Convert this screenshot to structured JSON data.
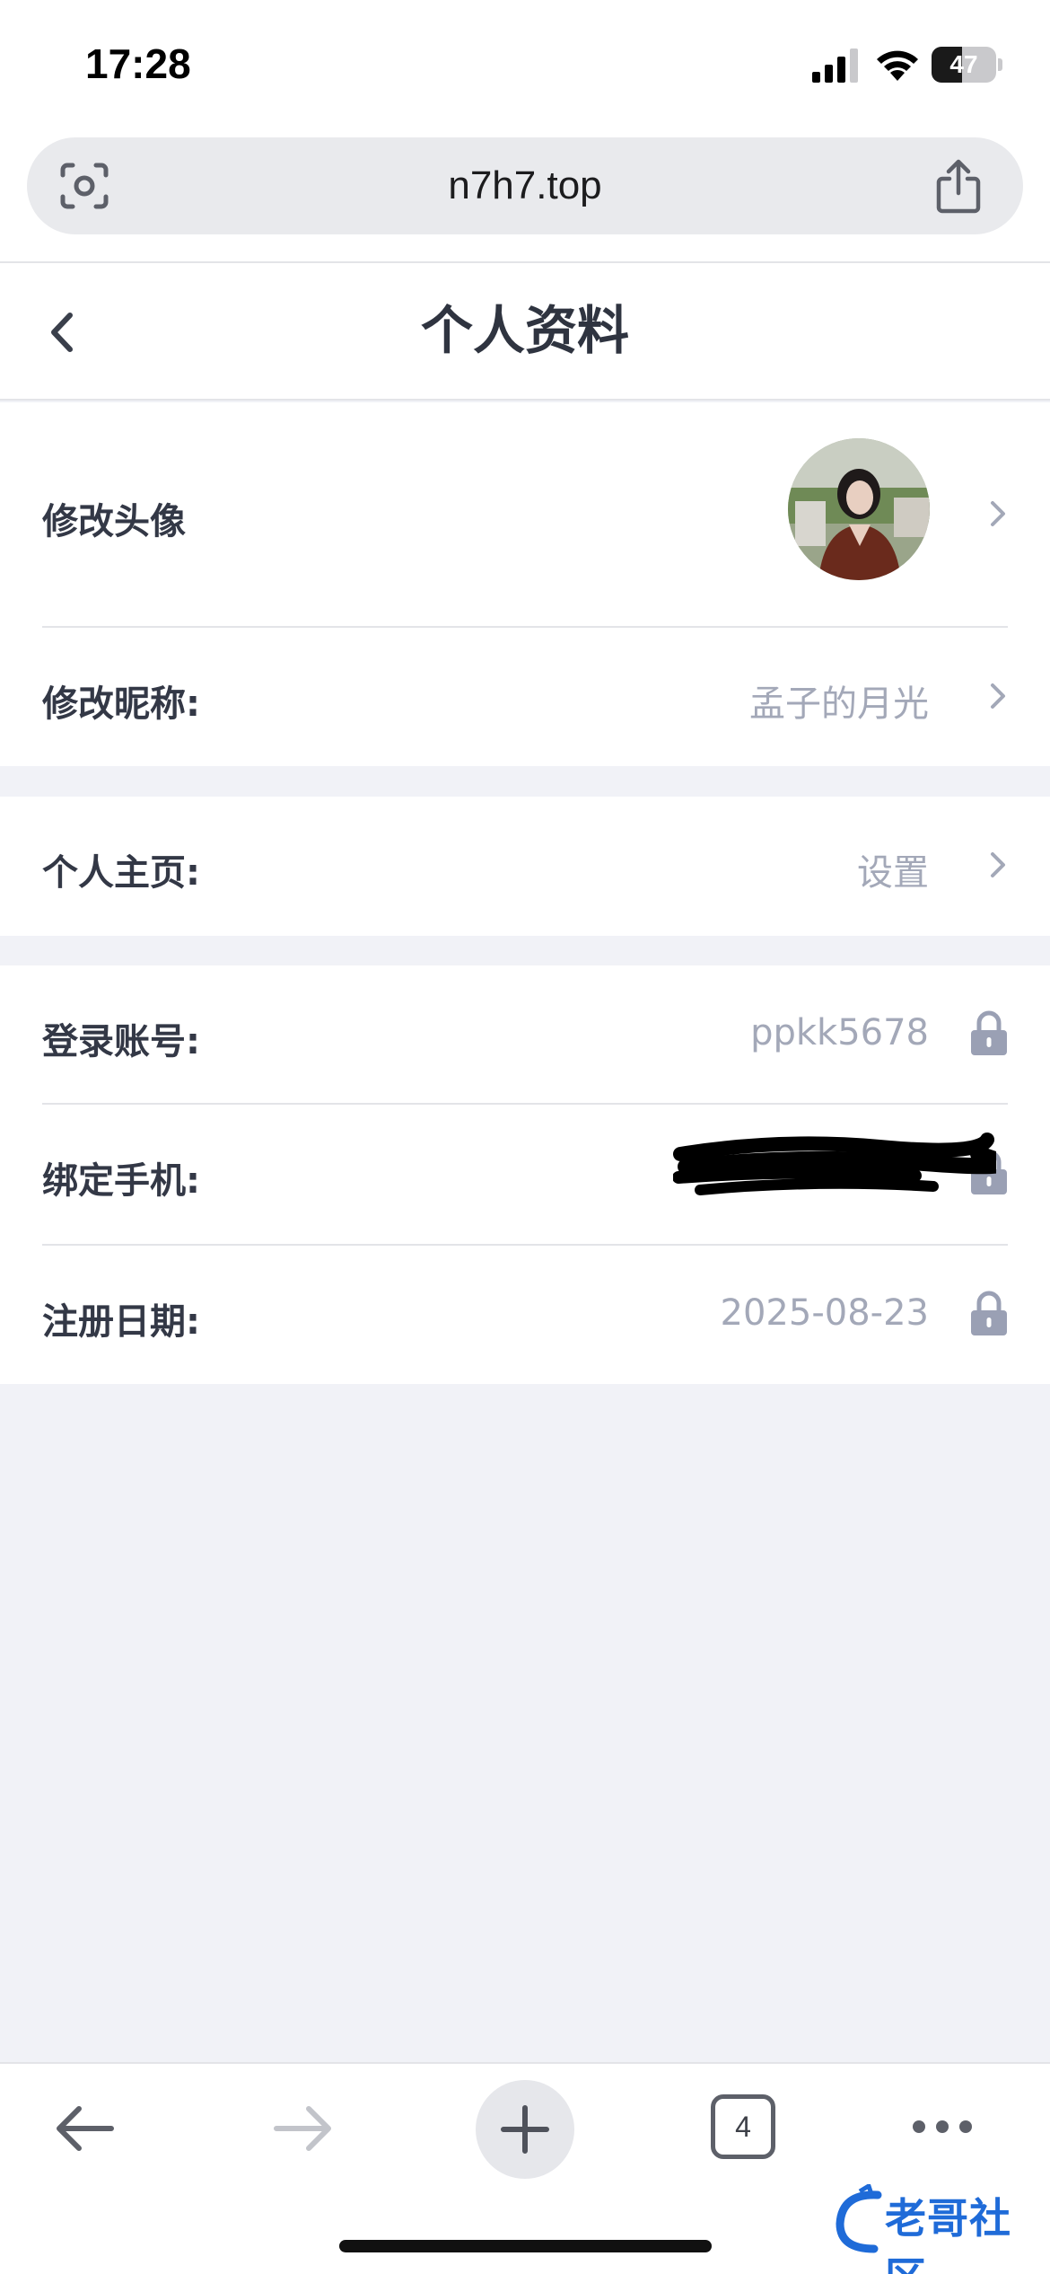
{
  "status_bar": {
    "time": "17:28",
    "battery_level": "47",
    "battery_fraction": 0.47
  },
  "browser": {
    "url": "n7h7.top",
    "tab_count": "4"
  },
  "header": {
    "title": "个人资料"
  },
  "profile": {
    "avatar_label": "修改头像",
    "nickname_label": "修改昵称:",
    "nickname_value": "孟子的月光",
    "homepage_label": "个人主页:",
    "homepage_value": "设置",
    "account_label": "登录账号:",
    "account_value": "ppkk5678",
    "phone_label": "绑定手机:",
    "register_label": "注册日期:",
    "register_value": "2025-08-23"
  },
  "watermark": {
    "text": "老哥社区"
  },
  "colors": {
    "page_background": "#f1f2f7",
    "value_gray": "#a3a8b8",
    "lock_gray": "#9aa0b4",
    "label_dark": "#333846"
  },
  "icons": {
    "camera_lens": "lens-icon",
    "share": "share-icon",
    "back": "chevron-left-icon",
    "row_arrow": "chevron-right-icon",
    "locked": "lock-icon",
    "nav_back": "arrow-left-icon",
    "nav_forward": "arrow-right-icon",
    "new_tab": "plus-icon",
    "more": "ellipsis-icon"
  }
}
